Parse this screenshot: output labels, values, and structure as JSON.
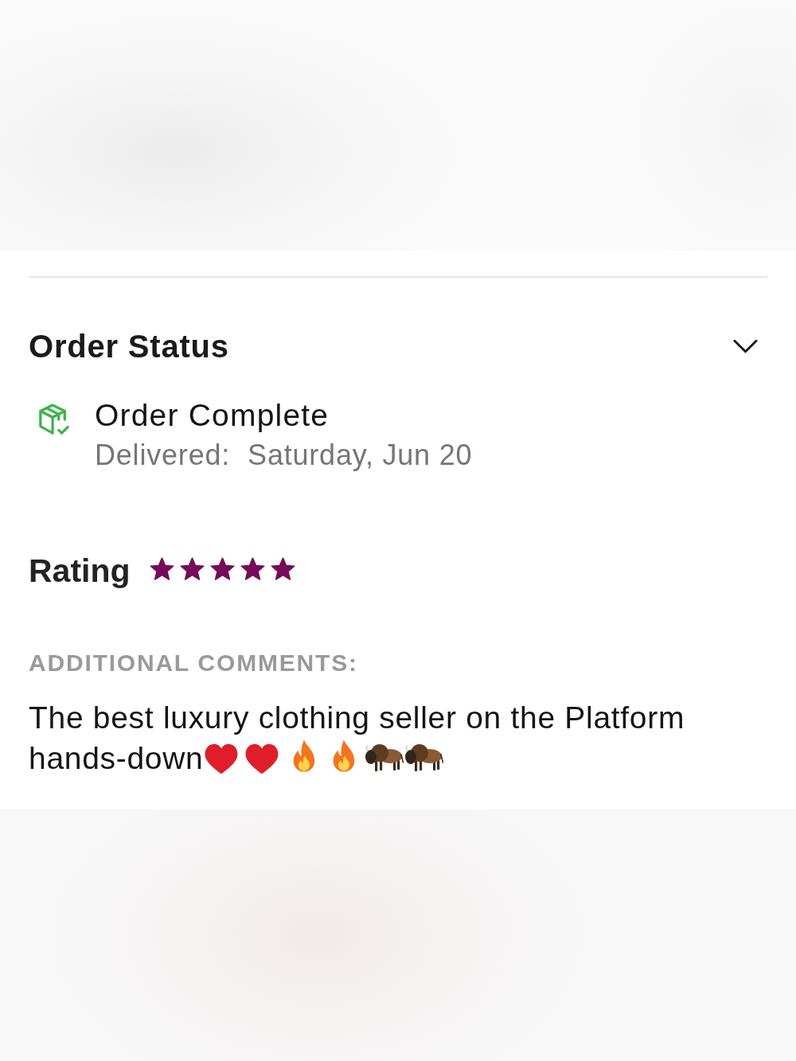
{
  "order_status": {
    "title": "Order Status",
    "status": "Order Complete",
    "delivered_label": "Delivered:",
    "delivered_date": "Saturday, Jun 20"
  },
  "rating": {
    "label": "Rating",
    "stars": 5
  },
  "comments": {
    "heading": "ADDITIONAL COMMENTS:",
    "text": "The best luxury clothing seller on the Platform hands-down",
    "emojis": [
      {
        "kind": "heart"
      },
      {
        "kind": "heart"
      },
      {
        "kind": "fire"
      },
      {
        "kind": "fire"
      },
      {
        "kind": "bison"
      },
      {
        "kind": "bison"
      }
    ]
  }
}
